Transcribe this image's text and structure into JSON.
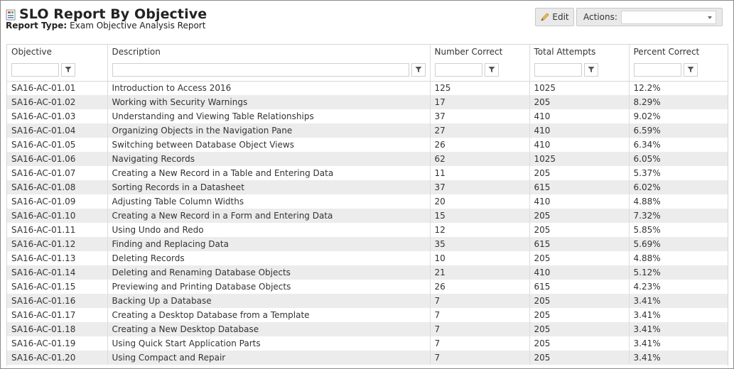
{
  "header": {
    "title": "SLO Report By Objective",
    "report_type_label": "Report Type:",
    "report_type_value": "Exam Objective Analysis Report",
    "icon": "report-icon"
  },
  "toolbar": {
    "edit_label": "Edit",
    "edit_icon": "pencil-icon",
    "actions_label": "Actions:",
    "actions_value": ""
  },
  "table": {
    "columns": [
      "Objective",
      "Description",
      "Number Correct",
      "Total Attempts",
      "Percent Correct"
    ],
    "filter_icon": "filter-icon",
    "rows": [
      [
        "SA16-AC-01.01",
        "Introduction to Access 2016",
        "125",
        "1025",
        "12.2%"
      ],
      [
        "SA16-AC-01.02",
        "Working with Security Warnings",
        "17",
        "205",
        "8.29%"
      ],
      [
        "SA16-AC-01.03",
        "Understanding and Viewing Table Relationships",
        "37",
        "410",
        "9.02%"
      ],
      [
        "SA16-AC-01.04",
        "Organizing Objects in the Navigation Pane",
        "27",
        "410",
        "6.59%"
      ],
      [
        "SA16-AC-01.05",
        "Switching between Database Object Views",
        "26",
        "410",
        "6.34%"
      ],
      [
        "SA16-AC-01.06",
        "Navigating Records",
        "62",
        "1025",
        "6.05%"
      ],
      [
        "SA16-AC-01.07",
        "Creating a New Record in a Table and Entering Data",
        "11",
        "205",
        "5.37%"
      ],
      [
        "SA16-AC-01.08",
        "Sorting Records in a Datasheet",
        "37",
        "615",
        "6.02%"
      ],
      [
        "SA16-AC-01.09",
        "Adjusting Table Column Widths",
        "20",
        "410",
        "4.88%"
      ],
      [
        "SA16-AC-01.10",
        "Creating a New Record in a Form and Entering Data",
        "15",
        "205",
        "7.32%"
      ],
      [
        "SA16-AC-01.11",
        "Using Undo and Redo",
        "12",
        "205",
        "5.85%"
      ],
      [
        "SA16-AC-01.12",
        "Finding and Replacing Data",
        "35",
        "615",
        "5.69%"
      ],
      [
        "SA16-AC-01.13",
        "Deleting Records",
        "10",
        "205",
        "4.88%"
      ],
      [
        "SA16-AC-01.14",
        "Deleting and Renaming Database Objects",
        "21",
        "410",
        "5.12%"
      ],
      [
        "SA16-AC-01.15",
        "Previewing and Printing Database Objects",
        "26",
        "615",
        "4.23%"
      ],
      [
        "SA16-AC-01.16",
        "Backing Up a Database",
        "7",
        "205",
        "3.41%"
      ],
      [
        "SA16-AC-01.17",
        "Creating a Desktop Database from a Template",
        "7",
        "205",
        "3.41%"
      ],
      [
        "SA16-AC-01.18",
        "Creating a New Desktop Database",
        "7",
        "205",
        "3.41%"
      ],
      [
        "SA16-AC-01.19",
        "Using Quick Start Application Parts",
        "7",
        "205",
        "3.41%"
      ],
      [
        "SA16-AC-01.20",
        "Using Compact and Repair",
        "7",
        "205",
        "3.41%"
      ]
    ]
  },
  "colors": {
    "border": "#8a8a8a",
    "alt_row": "#ececec",
    "button_bg": "#e9e9e9",
    "pencil": "#e0a030"
  }
}
